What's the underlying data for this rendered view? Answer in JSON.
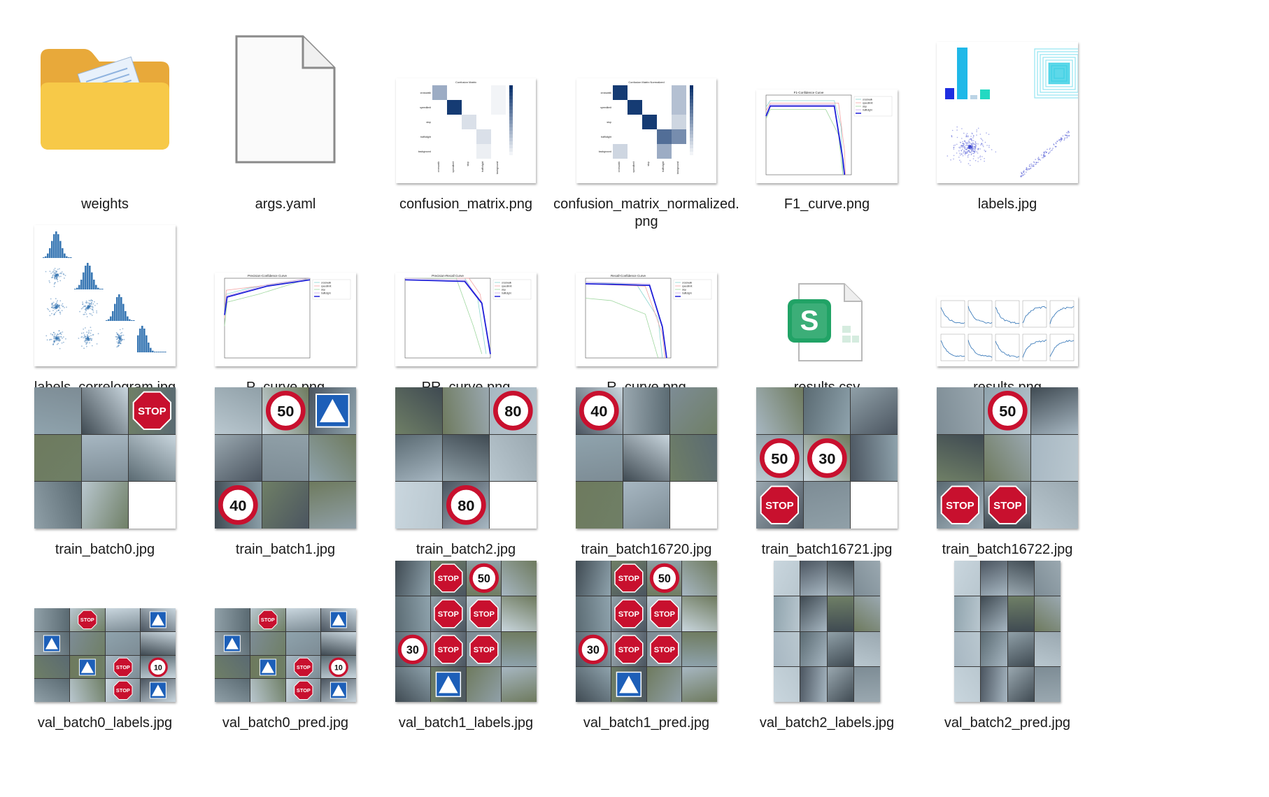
{
  "files": [
    {
      "name": "weights",
      "type": "folder"
    },
    {
      "name": "args.yaml",
      "type": "blank-document"
    },
    {
      "name": "confusion_matrix.png",
      "type": "confusion-matrix-thumbnail"
    },
    {
      "name": "confusion_matrix_normalized.png",
      "type": "confusion-matrix-thumbnail"
    },
    {
      "name": "F1_curve.png",
      "type": "curve-plot-thumbnail"
    },
    {
      "name": "labels.jpg",
      "type": "labels-plot-thumbnail"
    },
    {
      "name": "labels_correlogram.jpg",
      "type": "correlogram-thumbnail"
    },
    {
      "name": "P_curve.png",
      "type": "curve-plot-thumbnail"
    },
    {
      "name": "PR_curve.png",
      "type": "curve-plot-thumbnail"
    },
    {
      "name": "R_curve.png",
      "type": "curve-plot-thumbnail"
    },
    {
      "name": "results.csv",
      "type": "spreadsheet"
    },
    {
      "name": "results.png",
      "type": "results-plot-thumbnail"
    },
    {
      "name": "train_batch0.jpg",
      "type": "photo-mosaic-thumbnail"
    },
    {
      "name": "train_batch1.jpg",
      "type": "photo-mosaic-thumbnail"
    },
    {
      "name": "train_batch2.jpg",
      "type": "photo-mosaic-thumbnail"
    },
    {
      "name": "train_batch16720.jpg",
      "type": "photo-mosaic-thumbnail"
    },
    {
      "name": "train_batch16721.jpg",
      "type": "photo-mosaic-thumbnail"
    },
    {
      "name": "train_batch16722.jpg",
      "type": "photo-mosaic-thumbnail"
    },
    {
      "name": "val_batch0_labels.jpg",
      "type": "photo-mosaic-thumbnail"
    },
    {
      "name": "val_batch0_pred.jpg",
      "type": "photo-mosaic-thumbnail"
    },
    {
      "name": "val_batch1_labels.jpg",
      "type": "photo-mosaic-thumbnail"
    },
    {
      "name": "val_batch1_pred.jpg",
      "type": "photo-mosaic-thumbnail"
    },
    {
      "name": "val_batch2_labels.jpg",
      "type": "photo-mosaic-thumbnail"
    },
    {
      "name": "val_batch2_pred.jpg",
      "type": "photo-mosaic-thumbnail"
    }
  ],
  "thumb_text": {
    "confusion_matrix_title": "Confusion Matrix",
    "confusion_matrix_normalized_title": "Confusion Matrix Normalized",
    "classes": [
      "crosswalk",
      "speedlimit",
      "stop",
      "trafficlight",
      "background"
    ],
    "f1_title": "F1-Confidence Curve",
    "p_title": "Precision-Confidence Curve",
    "pr_title": "Precision-Recall Curve",
    "r_title": "Recall-Confidence Curve",
    "sheet_letter": "S",
    "stop_text": "STOP",
    "sign_50": "50",
    "sign_40": "40",
    "sign_30": "30",
    "sign_10": "10",
    "sign_80": "80"
  },
  "colors": {
    "folder": "#f7c948",
    "folder_dark": "#e8a93a",
    "matrix_dark": "#08306b",
    "matrix_light": "#deebf7",
    "curve_all": "#1f1fd8",
    "sheet_green": "#21a366",
    "stop_red": "#c8102e"
  }
}
